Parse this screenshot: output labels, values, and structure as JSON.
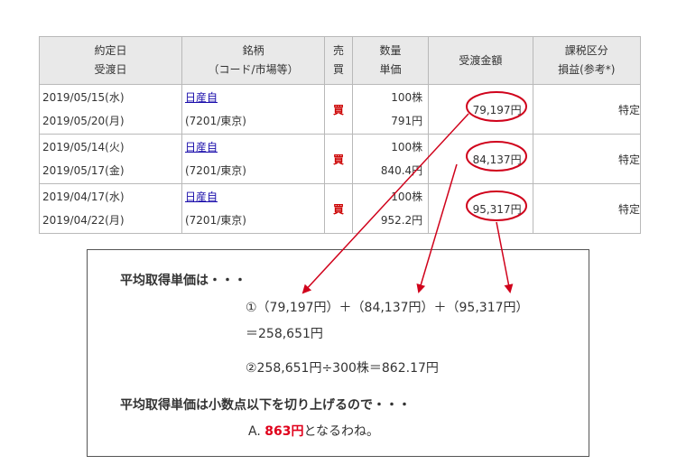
{
  "table": {
    "headers": {
      "date_top": "約定日",
      "date_bottom": "受渡日",
      "brand_top": "銘柄",
      "brand_bottom": "（コード/市場等）",
      "side_top": "売",
      "side_bottom": "買",
      "qty_top": "数量",
      "qty_bottom": "単価",
      "amount": "受渡金額",
      "tax_top": "課税区分",
      "tax_bottom": "損益(参考*)"
    },
    "rows": [
      {
        "trade_date": "2019/05/15(水)",
        "settle_date": "2019/05/20(月)",
        "brand": "日産自",
        "code": "(7201/東京)",
        "side": "買",
        "qty": "100株",
        "price": "791円",
        "amount": "79,197円",
        "tax": "特定"
      },
      {
        "trade_date": "2019/05/14(火)",
        "settle_date": "2019/05/17(金)",
        "brand": "日産自",
        "code": "(7201/東京)",
        "side": "買",
        "qty": "100株",
        "price": "840.4円",
        "amount": "84,137円",
        "tax": "特定"
      },
      {
        "trade_date": "2019/04/17(水)",
        "settle_date": "2019/04/22(月)",
        "brand": "日産自",
        "code": "(7201/東京)",
        "side": "買",
        "qty": "100株",
        "price": "952.2円",
        "amount": "95,317円",
        "tax": "特定"
      }
    ]
  },
  "explanation": {
    "heading1": "平均取得単価は・・・",
    "formula1": "①（79,197円）＋（84,137円）＋（95,317円）",
    "result1": "＝258,651円",
    "formula2": "②258,651円÷300株＝862.17円",
    "heading2": "平均取得単価は小数点以下を切り上げるので・・・",
    "answer_prefix": "A. ",
    "answer_value": "863円",
    "answer_suffix": "となるわね。"
  },
  "colors": {
    "highlight": "#d0021b",
    "header_bg": "#e9e9e9",
    "link": "#1a0dab"
  }
}
